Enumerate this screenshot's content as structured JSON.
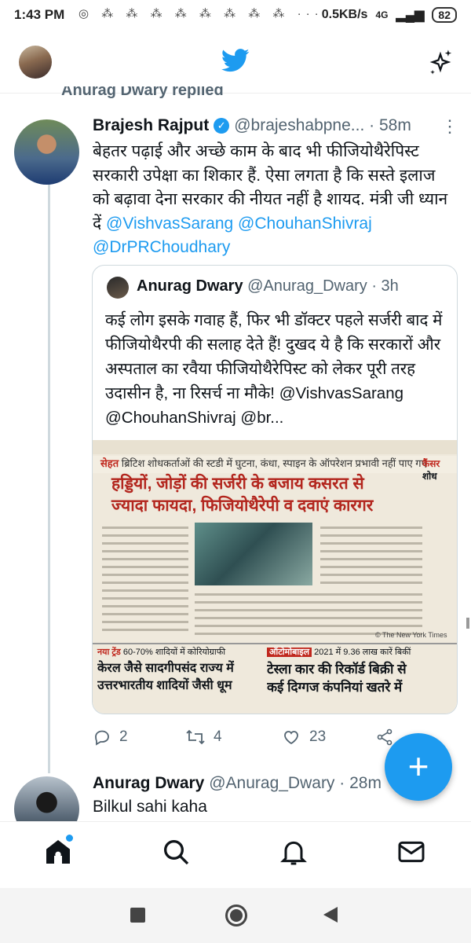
{
  "status_bar": {
    "time": "1:43 PM",
    "network_speed": "0.5KB/s",
    "network_type": "4G",
    "battery": "82"
  },
  "header": {
    "logo_icon": "twitter-bird-icon",
    "sparkle_icon": "sparkle-icon"
  },
  "thread": {
    "replied_label": "Anurag Dwary replied"
  },
  "tweet": {
    "author_name": "Brajesh Rajput",
    "handle": "@brajeshabpne...",
    "time": "58m",
    "text_plain": "बेहतर पढ़ाई और अच्छे काम के बाद भी फीजियोथैरेपिस्ट सरकारी उपेक्षा का शिकार हैं. ऐसा लगता है कि सस्ते इलाज को बढ़ावा देना सरकार की नीयत नहीं है शायद. मंत्री जी ध्यान दें",
    "mention_1": "@VishvasSarang",
    "mention_2": "@ChouhanShivraj",
    "mention_3": "@DrPRChoudhary",
    "quote": {
      "name": "Anurag Dwary",
      "handle": "@Anurag_Dwary",
      "time": "3h",
      "text": "कई लोग इसके गवाह हैं, फिर भी डॉक्टर पहले सर्जरी बाद में फीजियोथैरपी की सलाह देते हैं! दुखद ये है कि सरकारों और अस्पताल का रवैया फीजियोथैरेपिस्ट को लेकर पूरी तरह उदासीन है, ना रिसर्च ना मौके!",
      "mentions": "@VishvasSarang @ChouhanShivraj @br...",
      "image": {
        "kicker": "सेहत",
        "subhead": "ब्रिटिश शोधकर्ताओं की स्टडी में घुटना, कंधा, स्पाइन के ऑपरेशन प्रभावी नहीं पाए गए",
        "headline_1": "हड्डियों, जोड़ों की सर्जरी के बजाय कसरत से",
        "headline_2": "ज्यादा फायदा, फिजियोथैरेपी व दवाएं कारगर",
        "side_label": "कैंसर",
        "side_word": "शोध",
        "bottom_left_kicker": "नया ट्रेंड",
        "bottom_left_sub": "60-70% शादियों में कोरियोग्राफी",
        "bottom_left_head_1": "केरल जैसे सादगीपसंद राज्य में",
        "bottom_left_head_2": "उत्तरभारतीय शादियों जैसी धूम",
        "bottom_right_kicker": "ऑटोमोबाइल",
        "bottom_right_sub": "2021 में 9.36 लाख कारें बिकीं",
        "bottom_right_head_1": "टेस्ला कार की रिकॉर्ड बिक्री से",
        "bottom_right_head_2": "कई दिग्गज कंपनियां खतरे में",
        "credit": "© The New York Times"
      }
    },
    "actions": {
      "replies": "2",
      "retweets": "4",
      "likes": "23"
    }
  },
  "reply": {
    "name": "Anurag Dwary",
    "handle": "@Anurag_Dwary",
    "time": "28m",
    "text": "Bilkul sahi kaha"
  },
  "colors": {
    "accent": "#1d9bf0",
    "muted": "#536471",
    "border": "#cfd9de"
  }
}
